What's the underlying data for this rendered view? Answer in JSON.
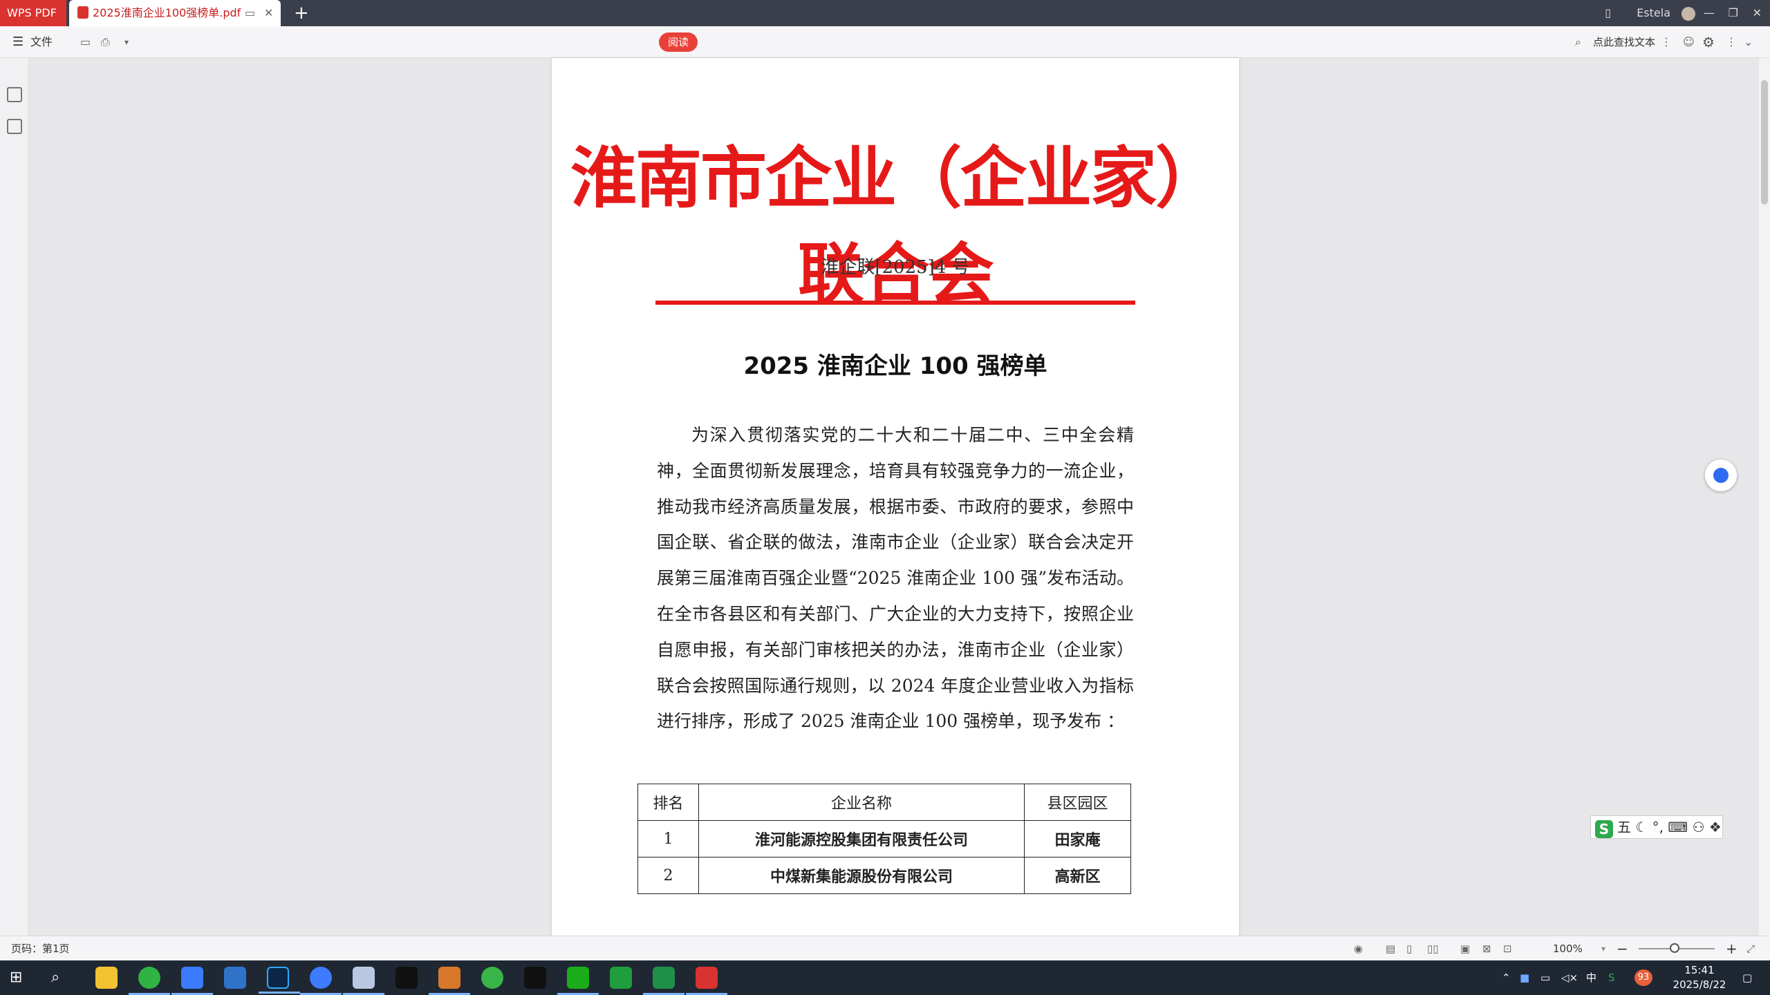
{
  "titlebar": {
    "app_label": "WPS PDF",
    "doc_tab": "2025淮南企业100强榜单.pdf",
    "new_tab": "+",
    "user": "Estela",
    "minimize": "—",
    "maximize": "❐",
    "close": "✕"
  },
  "toolbar": {
    "menu_label": "文件",
    "read_button": "阅读",
    "search_label": "点此查找文本"
  },
  "document": {
    "org_title": "淮南市企业（企业家）联合会",
    "doc_number": "淮企联[2025]4 号",
    "title": "2025 淮南企业 100 强榜单",
    "body": "为深入贯彻落实党的二十大和二十届二中、三中全会精神，全面贯彻新发展理念，培育具有较强竞争力的一流企业，推动我市经济高质量发展，根据市委、市政府的要求，参照中国企联、省企联的做法，淮南市企业（企业家）联合会决定开展第三届淮南百强企业暨“2025 淮南企业 100 强”发布活动。在全市各县区和有关部门、广大企业的大力支持下，按照企业自愿申报，有关部门审核把关的办法，淮南市企业（企业家）联合会按照国际通行规则，以 2024 年度企业营业收入为指标进行排序，形成了 2025 淮南企业 100 强榜单，现予发布 ：",
    "table": {
      "headers": [
        "排名",
        "企业名称",
        "县区园区"
      ],
      "rows": [
        [
          "1",
          "淮河能源控股集团有限责任公司",
          "田家庵"
        ],
        [
          "2",
          "中煤新集能源股份有限公司",
          "高新区"
        ]
      ]
    }
  },
  "ime": {
    "label": "五 ☾ °, ⌨ ⚇ ❖"
  },
  "statusbar": {
    "page_info": "页码：第1页",
    "zoom": "100%"
  },
  "taskbar": {
    "tray_lang": "中",
    "tray_badge": "93",
    "time": "15:41",
    "date": "2025/8/22"
  }
}
